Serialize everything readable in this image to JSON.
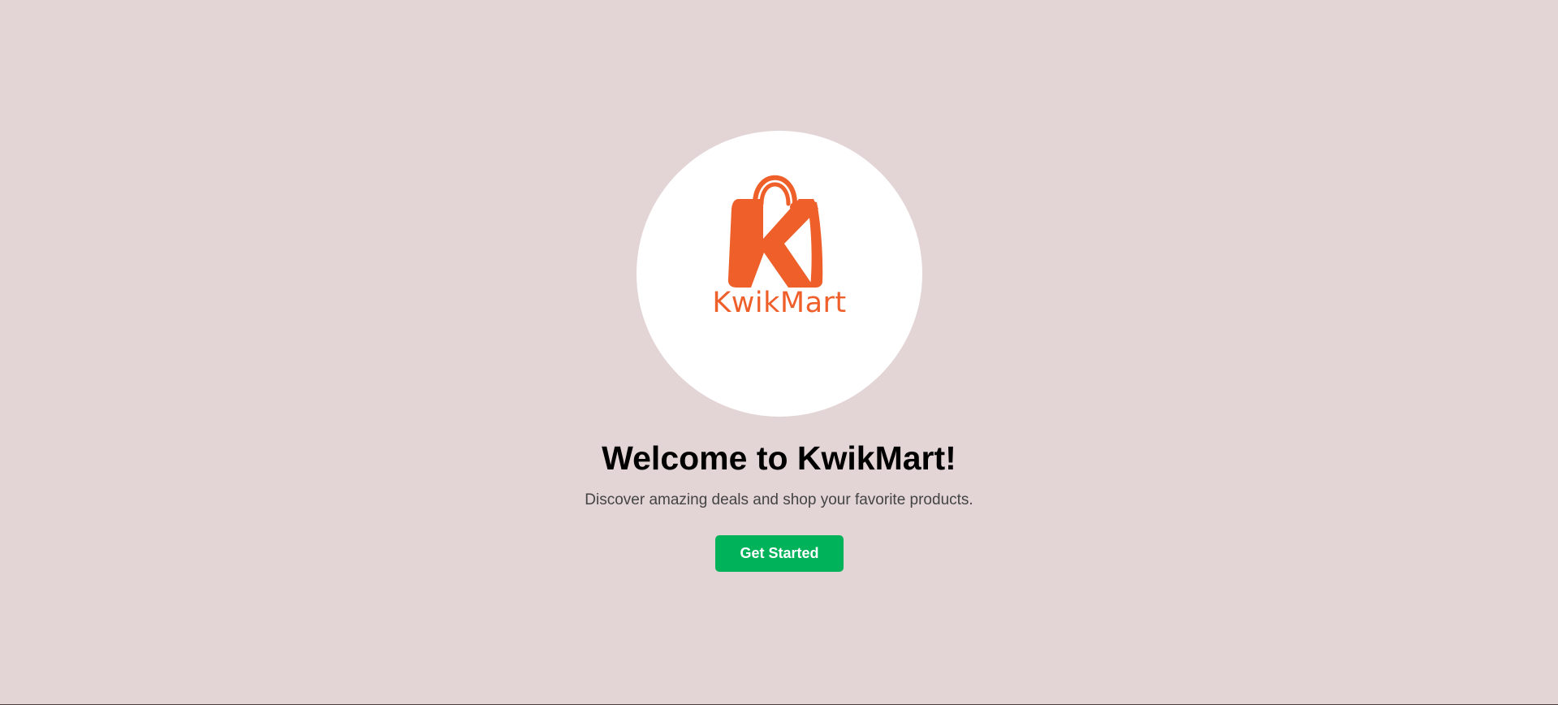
{
  "logo": {
    "brand_name": "KwikMart",
    "icon": "shopping-bag-k-icon",
    "brand_color": "#ee5f2a"
  },
  "welcome": {
    "title": "Welcome to KwikMart!",
    "subtitle": "Discover amazing deals and shop your favorite products."
  },
  "cta": {
    "label": "Get Started",
    "color": "#00b259"
  },
  "colors": {
    "background": "#e3d4d5",
    "circle": "#ffffff"
  }
}
